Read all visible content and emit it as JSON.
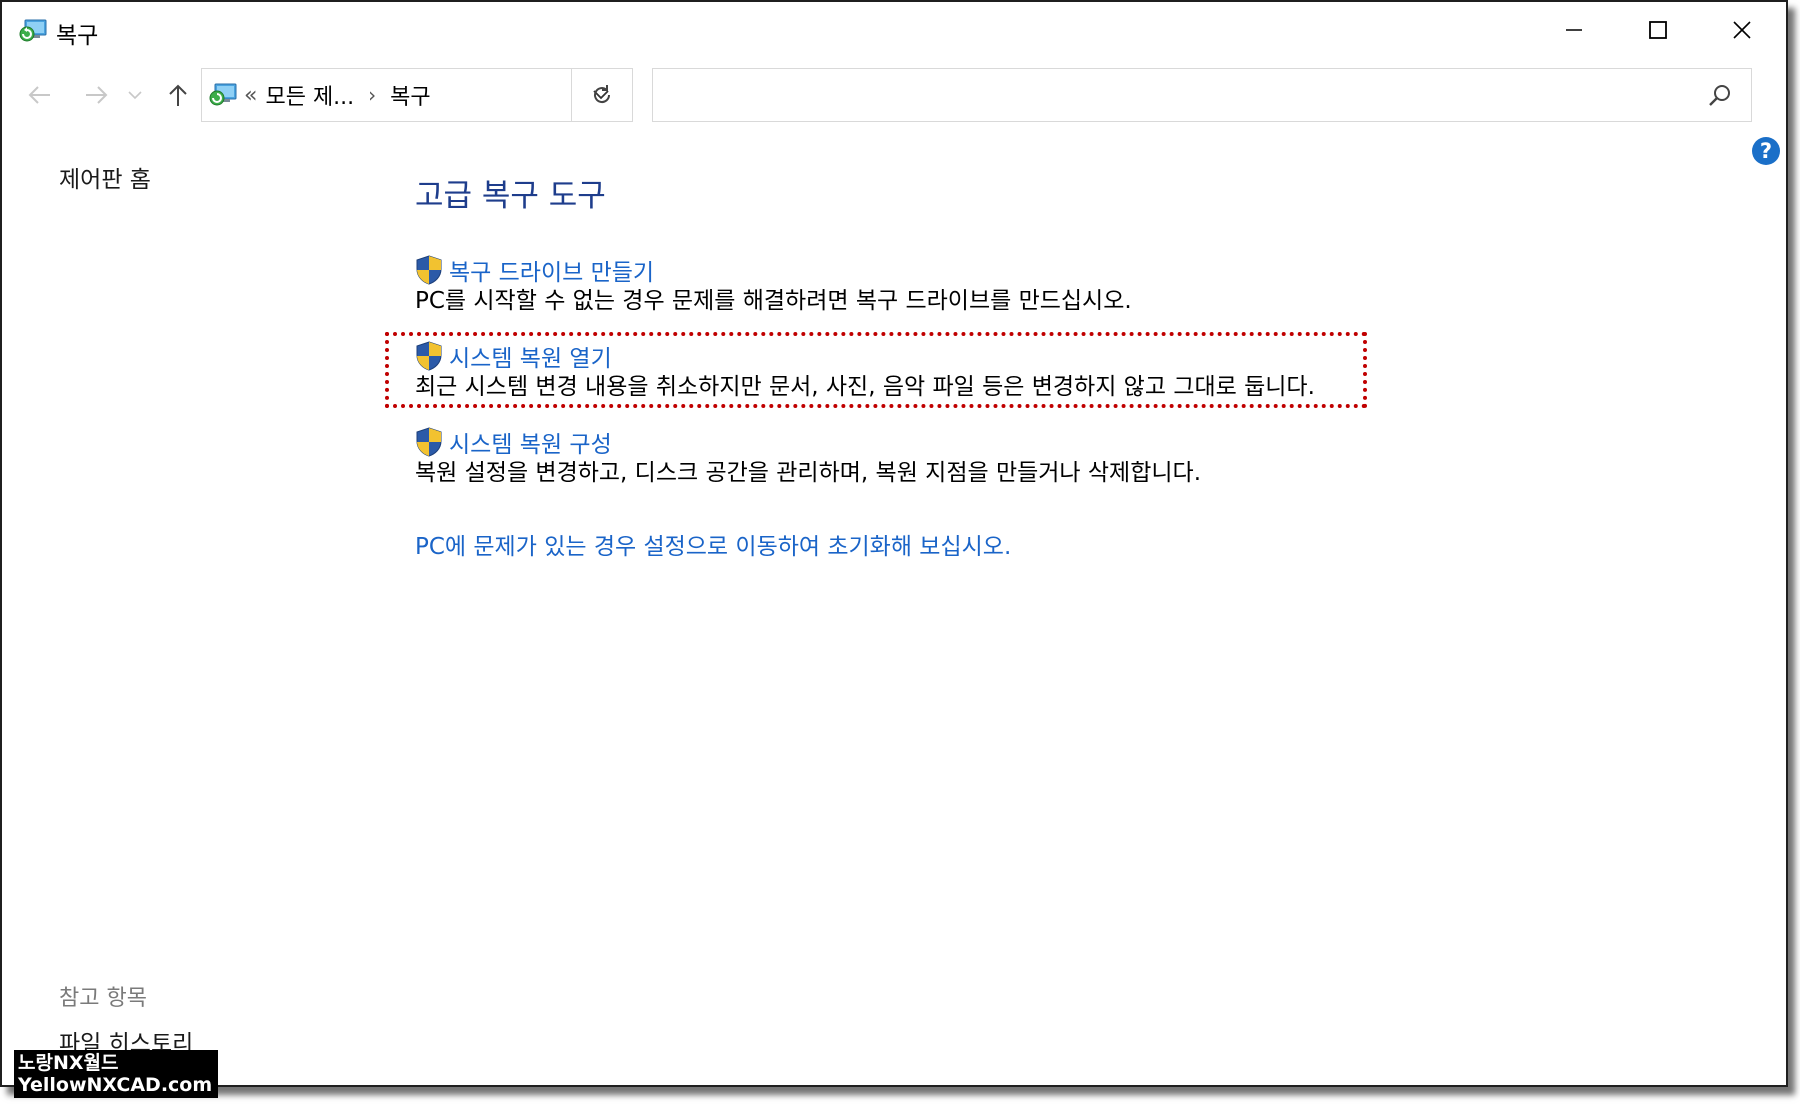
{
  "window": {
    "title": "복구"
  },
  "nav": {
    "address_prefix": "«",
    "address_segments": [
      "모든 제...",
      "복구"
    ],
    "address_separator": "›",
    "search_placeholder": ""
  },
  "left_pane": {
    "home_link": "제어판 홈",
    "see_also_title": "참고 항목",
    "see_also_items": [
      "파일 히스토리"
    ]
  },
  "main": {
    "title": "고급 복구 도구",
    "items": [
      {
        "link": "복구 드라이브 만들기",
        "description": "PC를 시작할 수 없는 경우 문제를 해결하려면 복구 드라이브를 만드십시오."
      },
      {
        "link": "시스템 복원 열기",
        "description": "최근 시스템 변경 내용을 취소하지만 문서, 사진, 음악 파일 등은 변경하지 않고 그대로 둡니다."
      },
      {
        "link": "시스템 복원 구성",
        "description": "복원 설정을 변경하고, 디스크 공간을 관리하며, 복원 지점을 만들거나 삭제합니다."
      }
    ],
    "reset_link": "PC에 문제가 있는 경우 설정으로 이동하여 초기화해 보십시오."
  },
  "help_label": "?",
  "watermark": {
    "line1": "노랑NX월드",
    "line2": "YellowNXCAD.com"
  },
  "colors": {
    "link": "#1a64c8",
    "title": "#1e3d8c",
    "highlight_border": "#c00000",
    "help": "#1a6fc8"
  }
}
